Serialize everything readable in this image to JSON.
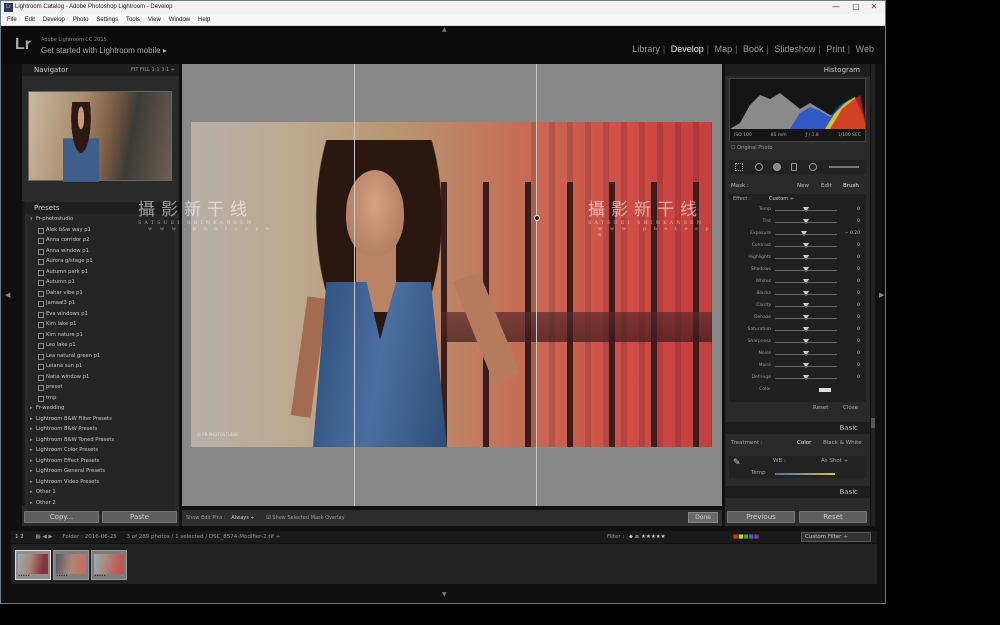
{
  "window": {
    "title": "Lightroom Catalog - Adobe Photoshop Lightroom - Develop",
    "min": "—",
    "max": "□",
    "close": "✕"
  },
  "menu": [
    "File",
    "Edit",
    "Develop",
    "Photo",
    "Settings",
    "Tools",
    "View",
    "Window",
    "Help"
  ],
  "identity": {
    "logo": "Lr",
    "small": "Adobe Lightroom CC 2015",
    "big": "Get started with Lightroom mobile ▸"
  },
  "modules": [
    "Library",
    "Develop",
    "Map",
    "Book",
    "Slideshow",
    "Print",
    "Web"
  ],
  "navigator": {
    "title": "Navigator",
    "opts": "FIT   FILL   1:1   3:1 ÷"
  },
  "presets": {
    "title": "Presets",
    "items": [
      {
        "label": "Fr-photostudio",
        "type": "grp open"
      },
      {
        "label": "Alek b&w way p1",
        "type": "sub"
      },
      {
        "label": "Anna corridor p2",
        "type": "sub"
      },
      {
        "label": "Anna window p1",
        "type": "sub"
      },
      {
        "label": "Aurora g/stage p1",
        "type": "sub"
      },
      {
        "label": "Autumn park p1",
        "type": "sub"
      },
      {
        "label": "Autumn p1",
        "type": "sub"
      },
      {
        "label": "Dahar vibe p1",
        "type": "sub"
      },
      {
        "label": "Jamaal3 p1",
        "type": "sub"
      },
      {
        "label": "Eva windows p1",
        "type": "sub"
      },
      {
        "label": "Kim lake p1",
        "type": "sub"
      },
      {
        "label": "Kim nature p1",
        "type": "sub"
      },
      {
        "label": "Leo lake p1",
        "type": "sub"
      },
      {
        "label": "Lea natural green p1",
        "type": "sub"
      },
      {
        "label": "Leiana sun p1",
        "type": "sub"
      },
      {
        "label": "Natia window p1",
        "type": "sub"
      },
      {
        "label": "preset",
        "type": "sub"
      },
      {
        "label": "tmp",
        "type": "sub"
      },
      {
        "label": "Fr-wedding",
        "type": "grp"
      },
      {
        "label": "Lightroom B&W Filter Presets",
        "type": "grp"
      },
      {
        "label": "Lightroom B&W Presets",
        "type": "grp"
      },
      {
        "label": "Lightroom B&W Toned Presets",
        "type": "grp"
      },
      {
        "label": "Lightroom Color Presets",
        "type": "grp"
      },
      {
        "label": "Lightroom Effect Presets",
        "type": "grp"
      },
      {
        "label": "Lightroom General Presets",
        "type": "grp"
      },
      {
        "label": "Lightroom Video Presets",
        "type": "grp"
      },
      {
        "label": "Other 1",
        "type": "grp"
      },
      {
        "label": "Other 2",
        "type": "grp"
      }
    ]
  },
  "leftbuttons": {
    "copy": "Copy...",
    "paste": "Paste"
  },
  "watermark": {
    "cn": "攝影新干线",
    "en": "SATSUEI SHINKANSEN",
    "web": "w w w . p h o t o s p e"
  },
  "photo_credit": "© FR-PHOTOSTUDIO",
  "toolbar": {
    "edit_pins": "Show Edit Pins :",
    "always": "Always ÷",
    "overlay": "Show Selected Mask Overlay",
    "done": "Done"
  },
  "histogram": {
    "title": "Histogram",
    "iso": "ISO 100",
    "mm": "85 mm",
    "fstop": "ƒ / 1.8",
    "shutter": "1/100 SEC",
    "orig": "Original Photo"
  },
  "mask": {
    "label": "Mask :",
    "new": "New",
    "edit": "Edit",
    "brush": "Brush"
  },
  "effect": {
    "label": "Effect :",
    "value": "Custom ÷"
  },
  "sliders": [
    {
      "label": "Temp",
      "value": "0"
    },
    {
      "label": "Tint",
      "value": "0"
    },
    {
      "label": "Exposure",
      "value": "− 0.20"
    },
    {
      "label": "Contrast",
      "value": "0"
    },
    {
      "label": "Highlights",
      "value": "0"
    },
    {
      "label": "Shadows",
      "value": "0"
    },
    {
      "label": "Whites",
      "value": "0"
    },
    {
      "label": "Blacks",
      "value": "0"
    },
    {
      "label": "Clarity",
      "value": "0"
    },
    {
      "label": "Dehaze",
      "value": "0"
    },
    {
      "label": "Saturation",
      "value": "0"
    },
    {
      "label": "Sharpness",
      "value": "0"
    },
    {
      "label": "Noise",
      "value": "0"
    },
    {
      "label": "Moiré",
      "value": "0"
    },
    {
      "label": "Defringe",
      "value": "0"
    },
    {
      "label": "Color",
      "value": ""
    }
  ],
  "effbtns": {
    "reset": "Reset",
    "close": "Close"
  },
  "basic": {
    "title": "Basic",
    "treatment": "Treatment :",
    "color": "Color",
    "bw": "Black & White",
    "wb": "WB :",
    "asshot": "As Shot ÷",
    "temp": "Temp",
    "title2": "Basic"
  },
  "rightbuttons": {
    "previous": "Previous",
    "reset": "Reset"
  },
  "filmbar": {
    "pages": "1  2",
    "folder": "Folder : 2016-06-25",
    "info": "3 of 289 photos / 1 selected / DSC_8574-Modifier-2.tif ÷",
    "filter": "Filter :",
    "custom": "Custom Filter ÷"
  }
}
